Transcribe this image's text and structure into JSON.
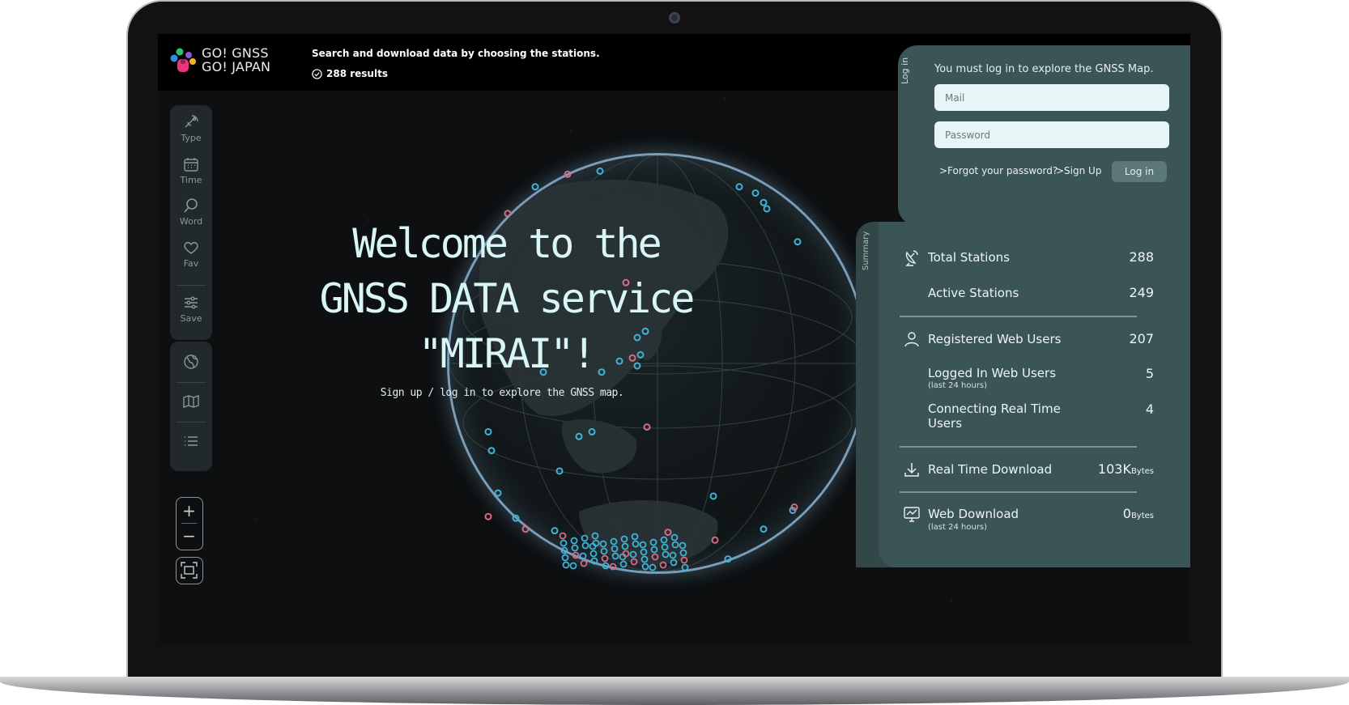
{
  "topbar": {
    "logo_line1": "GO! GNSS",
    "logo_line2": "GO! JAPAN",
    "tagline": "Search and download data by choosing the stations.",
    "results": "288 results"
  },
  "toolbar": {
    "items": [
      {
        "label": "Type",
        "icon": "satellite-icon"
      },
      {
        "label": "Time",
        "icon": "calendar-icon"
      },
      {
        "label": "Word",
        "icon": "search-icon"
      },
      {
        "label": "Fav",
        "icon": "heart-icon"
      },
      {
        "label": "Save",
        "icon": "sliders-icon"
      }
    ],
    "views": [
      "globe-icon",
      "map-icon",
      "list-icon"
    ],
    "zoom_in": "+",
    "zoom_out": "−"
  },
  "hero": {
    "line1": "Welcome to the",
    "line2": "GNSS DATA service",
    "line3": "\"MIRAI\"!",
    "subtitle": "Sign up / log in to explore the GNSS map."
  },
  "login": {
    "tab": "Log in",
    "message": "You must log in to explore the GNSS Map.",
    "mail_placeholder": "Mail",
    "password_placeholder": "Password",
    "forgot": ">Forgot your password?",
    "signup": ">Sign Up",
    "button": "Log in"
  },
  "summary": {
    "tab": "Summary",
    "total_stations": {
      "label": "Total Stations",
      "value": "288"
    },
    "active_stations": {
      "label": "Active Stations",
      "value": "249"
    },
    "registered_users": {
      "label": "Registered Web Users",
      "value": "207"
    },
    "logged_in_users": {
      "label": "Logged In Web Users",
      "sub": "(last 24 hours)",
      "value": "5"
    },
    "realtime_users": {
      "label1": "Connecting Real Time",
      "label2": "Users",
      "value": "4"
    },
    "realtime_download": {
      "label": "Real Time Download",
      "value": "103K",
      "unit": "Bytes"
    },
    "web_download": {
      "label": "Web Download",
      "sub": "(last 24 hours)",
      "value": "0",
      "unit": "Bytes"
    }
  },
  "colors": {
    "panel": "#3b5556",
    "accent_cyan": "#3fb3d8",
    "accent_pink": "#d96a86",
    "background": "#0d0f10"
  }
}
